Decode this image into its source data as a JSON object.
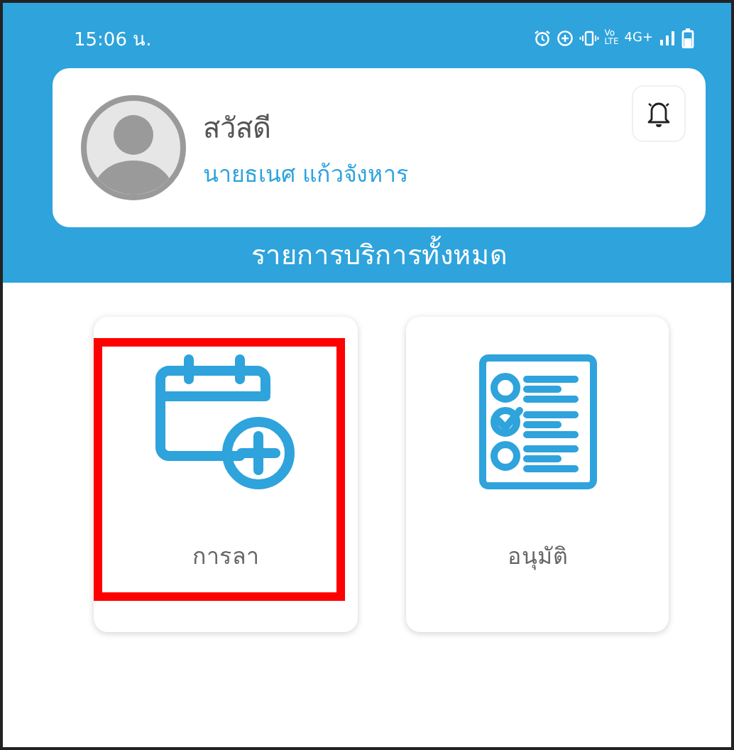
{
  "status_bar": {
    "time": "15:06 น.",
    "volte_top": "Vo",
    "volte_bottom": "LTE",
    "network": "4G+"
  },
  "profile": {
    "greeting": "สวัสดี",
    "name": "นายธเนศ แก้วจังหาร"
  },
  "section_title": "รายการบริการทั้งหมด",
  "services": [
    {
      "kind": "calendar-add",
      "label": "การลา",
      "highlighted": true
    },
    {
      "kind": "checklist",
      "label": "อนุมัติ",
      "highlighted": false
    }
  ]
}
